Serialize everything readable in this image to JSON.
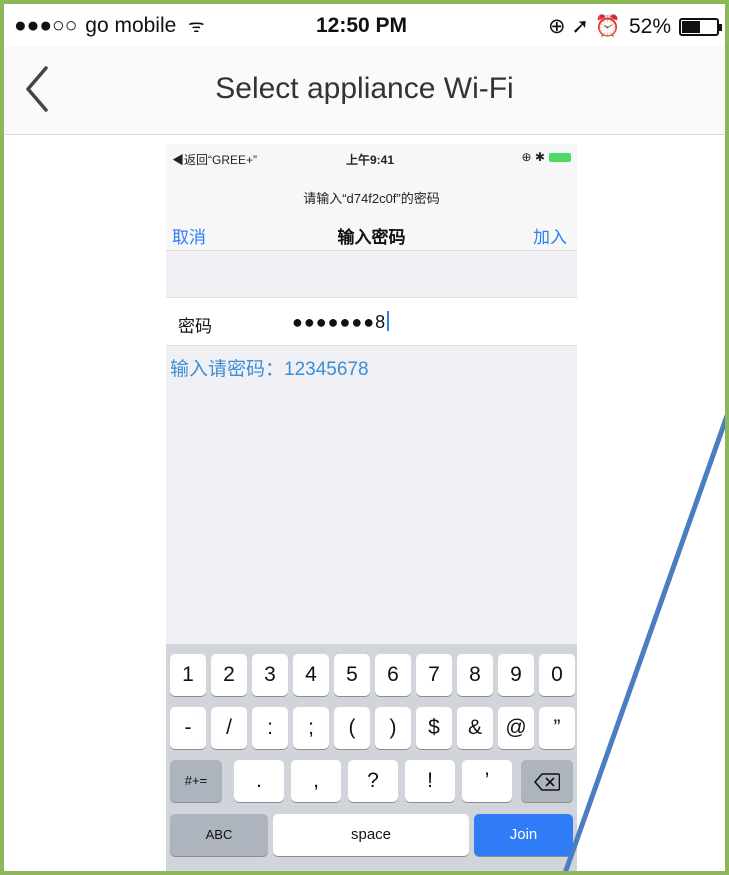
{
  "status_bar": {
    "signal": "●●●○○",
    "carrier": "go mobile",
    "wifi": "ᯤ",
    "time": "12:50 PM",
    "icons": "⊕ ➚ ⏰",
    "battery_text": "52%",
    "battery_level": 0.52
  },
  "nav": {
    "back_icon": "chevron-left-icon",
    "title": "Select appliance Wi-Fi"
  },
  "inner": {
    "status": {
      "back_to": "◀返回“GREE+”",
      "time": "上午9:41",
      "icons": "⊕ ✱"
    },
    "prompt": "请输入“d74f2c0f”的密码",
    "cancel": "取消",
    "title": "输入密码",
    "join": "加入",
    "password_label": "密码",
    "password_value": "●●●●●●●8",
    "hint": "输入请密码：12345678",
    "keyboard": {
      "row1": [
        "1",
        "2",
        "3",
        "4",
        "5",
        "6",
        "7",
        "8",
        "9",
        "0"
      ],
      "row2": [
        "-",
        "/",
        ":",
        ";",
        "(",
        ")",
        "$",
        "&",
        "@",
        "”"
      ],
      "row3_shift": "#+=",
      "row3": [
        ".",
        ",",
        "?",
        "!",
        "’"
      ],
      "backspace_icon": "backspace-icon",
      "abc": "ABC",
      "space": "space",
      "join": "Join"
    }
  },
  "colors": {
    "frame": "#8db85a",
    "accent": "#2e7cf6",
    "hint": "#3a8fd9",
    "annotation": "#4a7ec0"
  }
}
